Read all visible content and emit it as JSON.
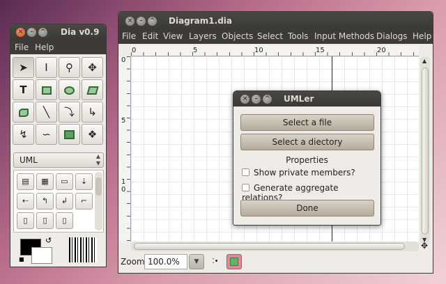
{
  "toolbox": {
    "title": "Dia v0.9",
    "menu": [
      "File",
      "Help"
    ],
    "sheet": "UML"
  },
  "diagram": {
    "title": "Diagram1.dia",
    "menu": [
      "File",
      "Edit",
      "View",
      "Layers",
      "Objects",
      "Select",
      "Tools",
      "Input Methods",
      "Dialogs",
      "Help"
    ],
    "ruler_h": [
      "0",
      "5",
      "10",
      "15",
      "20"
    ],
    "ruler_v": [
      "0",
      "5",
      "1",
      "0"
    ],
    "zoom_label": "Zoom",
    "zoom_value": "100.0%"
  },
  "umler": {
    "title": "UMLer",
    "select_file": "Select a file",
    "select_directory": "Select a diectory",
    "properties_label": "Properties",
    "show_private": "Show private members?",
    "aggregate": "Generate aggregate relations?",
    "done": "Done"
  }
}
